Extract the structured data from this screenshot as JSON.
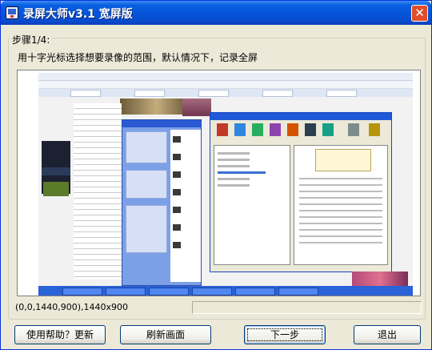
{
  "window": {
    "title": "录屏大师v3.1 宽屏版",
    "close_glyph": "✕"
  },
  "step": {
    "legend": "步骤1/4:",
    "instruction": "用十字光标选择想要录像的范围，默认情况下，记录全屏"
  },
  "status": {
    "region": "(0,0,1440,900),1440x900",
    "right": ""
  },
  "buttons": {
    "help": "使用帮助？更新",
    "refresh": "刷新画面",
    "next": "下一步",
    "exit": "退出"
  },
  "colors": {
    "titlebar": "#0554d8",
    "close": "#e04e2a",
    "background": "#ece9d8"
  },
  "icons": {
    "app": "app-icon",
    "close": "close-icon"
  }
}
